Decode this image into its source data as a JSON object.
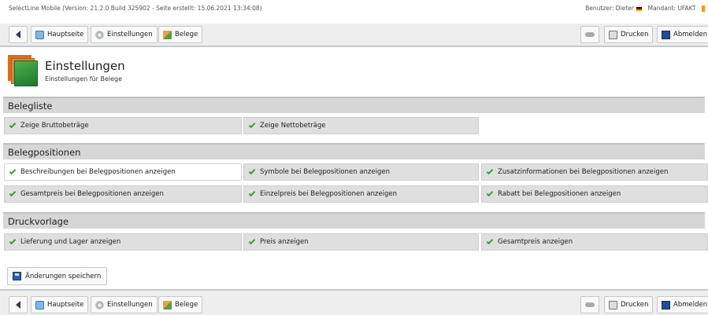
{
  "statusline": {
    "left": "SelectLine Mobile (Version: 21.2.0 Build 325902 - Seite erstellt: 15.06.2021 13:34:08)",
    "user": "Benutzer: Dieter",
    "mandant": "Mandant: UFAKT"
  },
  "toolbar": {
    "home_label": "Hauptseite",
    "settings_label": "Einstellungen",
    "belege_label": "Belege",
    "print_label": "Drucken",
    "logout_label": "Abmelden"
  },
  "header": {
    "title": "Einstellungen",
    "subtitle": "Einstellungen für Belege"
  },
  "sections": {
    "belegliste": {
      "title": "Belegliste",
      "options": [
        "Zeige Bruttobeträge",
        "Zeige Nettobeträge"
      ]
    },
    "belegpositionen": {
      "title": "Belegpositionen",
      "options": [
        "Beschreibungen bei Belegpositionen anzeigen",
        "Symbole bei Belegpositionen anzeigen",
        "Zusatzinformationen bei Belegpositionen anzeigen",
        "Gesamtpreis bei Belegpositionen anzeigen",
        "Einzelpreis bei Belegpositionen anzeigen",
        "Rabatt bei Belegpositionen anzeigen"
      ]
    },
    "druckvorlage": {
      "title": "Druckvorlage",
      "options": [
        "Lieferung und Lager anzeigen",
        "Preis anzeigen",
        "Gesamtpreis anzeigen"
      ]
    }
  },
  "save_label": "Änderungen speichern",
  "colors": {
    "check": "#3a9a3a",
    "section_bg": "#d6d6d6",
    "option_bg": "#dfdfdf",
    "toolbar_bg": "#eeeeee"
  }
}
